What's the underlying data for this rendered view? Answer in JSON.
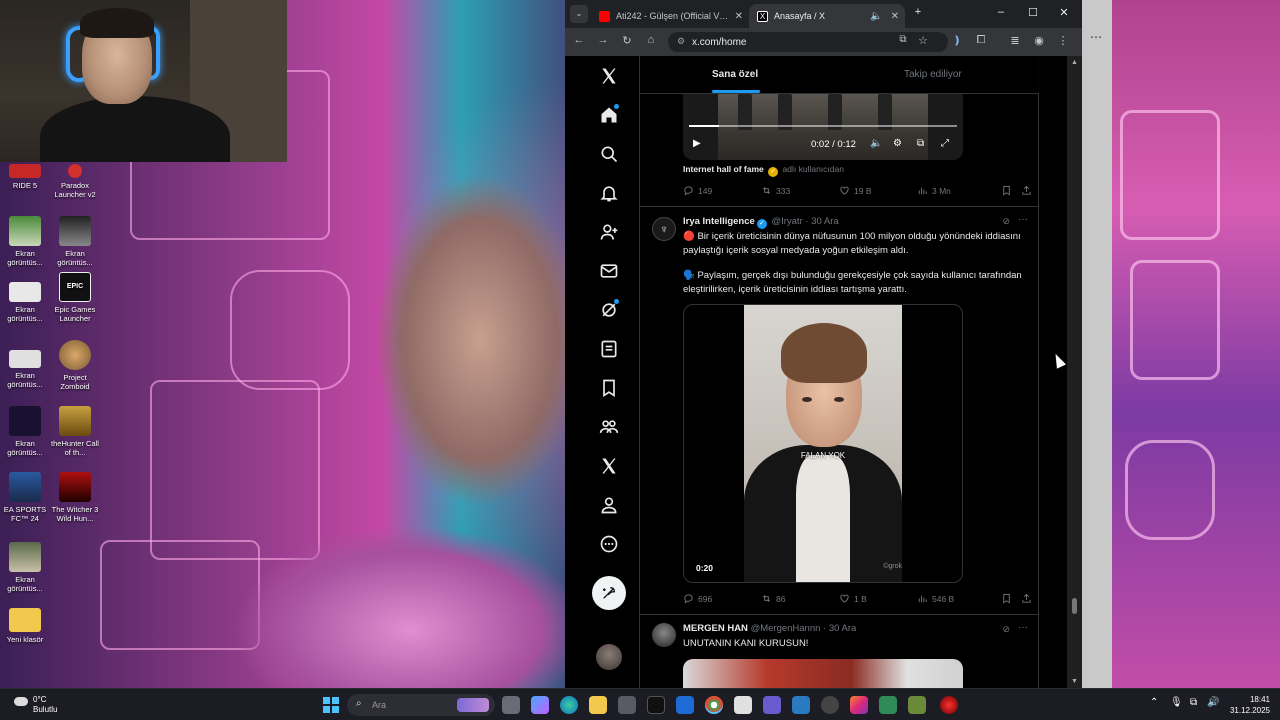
{
  "desktop": {
    "icons": [
      {
        "label": "RIDE 5"
      },
      {
        "label": "Paradox Launcher v2"
      },
      {
        "label": "Ekran görüntüs..."
      },
      {
        "label": "Ekran görüntüs..."
      },
      {
        "label": "Ekran görüntüs..."
      },
      {
        "label": "Epic Games Launcher"
      },
      {
        "label": "Ekran görüntüs..."
      },
      {
        "label": "Project Zomboid"
      },
      {
        "label": "Ekran görüntüs..."
      },
      {
        "label": "theHunter Call of th..."
      },
      {
        "label": "EA SPORTS FC™ 24"
      },
      {
        "label": "The Witcher 3 Wild Hun..."
      },
      {
        "label": "Ekran görüntüs..."
      },
      {
        "label": "Yeni klasör"
      }
    ]
  },
  "browser": {
    "tabs": [
      {
        "title": "Ati242 - Gülşen (Official Video)",
        "favicon_color": "#ff0000",
        "active": false
      },
      {
        "title": "Anasayfa / X",
        "favicon_color": "#000000",
        "active": true
      }
    ],
    "new_tab_label": "+",
    "url": "x.com/home",
    "window_controls": {
      "minimize": "–",
      "maximize": "☐",
      "close": "✕"
    }
  },
  "x": {
    "tabs": {
      "for_you": "Sana özel",
      "following": "Takip ediliyor"
    },
    "video1": {
      "time": "0:02 / 0:12"
    },
    "source_line": {
      "name": "Internet hall of fame",
      "suffix": "adlı kullanıcıdan"
    },
    "tweet1_stats": {
      "replies": "149",
      "reposts": "333",
      "likes": "19 B",
      "views": "3 Mn"
    },
    "tweet2": {
      "name": "Irya Intelligence",
      "handle": "@Iryatr",
      "date": "30 Ara",
      "text1": "🔴 Bir içerik üreticisinin dünya nüfusunun 100 milyon olduğu yönündeki iddiasını paylaştığı içerik sosyal medyada yoğun etkileşim aldı.",
      "text2": "🗣️ Paylaşım, gerçek dışı bulunduğu gerekçesiyle çok sayıda kullanıcı tarafından eleştirilirken, içerik üreticisinin iddiası tartışma yarattı.",
      "video_caption": "FALAN YOK",
      "video_time": "0:20",
      "video_watermark": "©grok",
      "stats": {
        "replies": "696",
        "reposts": "86",
        "likes": "1 B",
        "views": "546 B"
      }
    },
    "tweet3": {
      "name": "MERGEN HAN",
      "handle": "@MergenHannn",
      "date": "30 Ara",
      "text": "UNUTANIN KANI KURUSUN!"
    }
  },
  "taskbar": {
    "weather_temp": "0°C",
    "weather_desc": "Bulutlu",
    "search_placeholder": "Ara",
    "time": "18:41",
    "date": "31.12.2025"
  }
}
